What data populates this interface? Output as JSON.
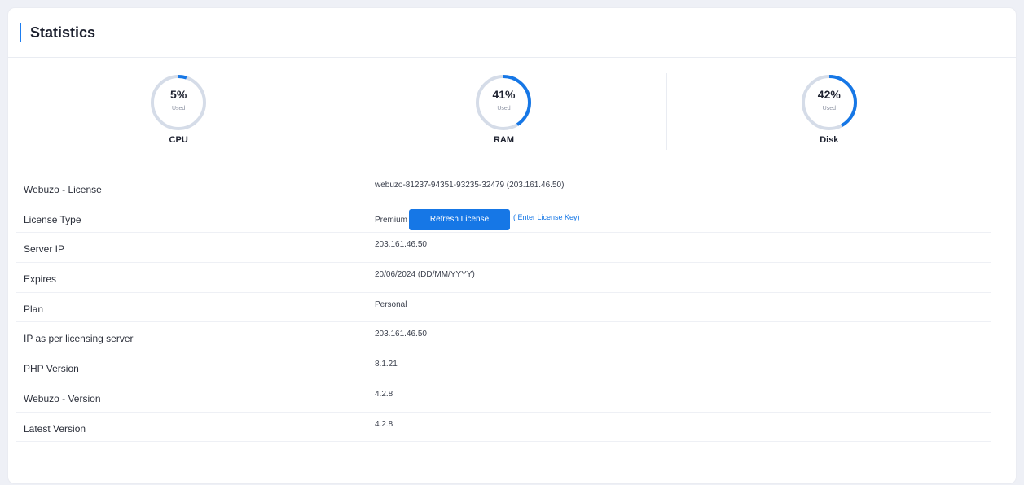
{
  "header": {
    "title": "Statistics"
  },
  "gauges": [
    {
      "key": "cpu",
      "label": "CPU",
      "value_text": "5%",
      "sub": "Used",
      "percent": 5
    },
    {
      "key": "ram",
      "label": "RAM",
      "value_text": "41%",
      "sub": "Used",
      "percent": 41
    },
    {
      "key": "disk",
      "label": "Disk",
      "value_text": "42%",
      "sub": "Used",
      "percent": 42
    }
  ],
  "colors": {
    "accent": "#1677e6",
    "track": "#d5dce8"
  },
  "info": {
    "license": {
      "label": "Webuzo - License",
      "value": "webuzo-81237-94351-93235-32479 (203.161.46.50)"
    },
    "license_type": {
      "label": "License Type",
      "value": "Premium",
      "refresh_button": "Refresh License",
      "enter_key": "( Enter License Key)"
    },
    "server_ip": {
      "label": "Server IP",
      "value": "203.161.46.50"
    },
    "expires": {
      "label": "Expires",
      "value": "20/06/2024 (DD/MM/YYYY)"
    },
    "plan": {
      "label": "Plan",
      "value": "Personal"
    },
    "licensing_ip": {
      "label": "IP as per licensing server",
      "value": "203.161.46.50"
    },
    "php_version": {
      "label": "PHP Version",
      "value": "8.1.21"
    },
    "webuzo_version": {
      "label": "Webuzo - Version",
      "value": "4.2.8"
    },
    "latest_version": {
      "label": "Latest Version",
      "value": "4.2.8"
    }
  }
}
